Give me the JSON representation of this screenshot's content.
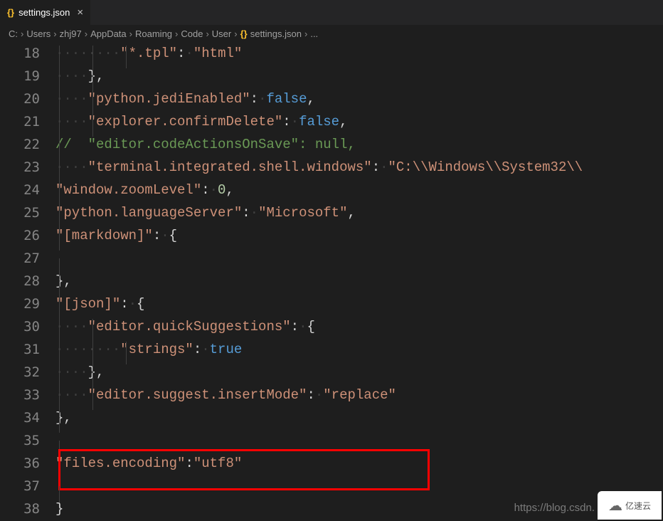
{
  "tab": {
    "icon": "{}",
    "title": "settings.json",
    "close": "×"
  },
  "breadcrumb": {
    "items": [
      "C:",
      "Users",
      "zhj97",
      "AppData",
      "Roaming",
      "Code",
      "User"
    ],
    "file_icon": "{}",
    "file": "settings.json",
    "trail": "..."
  },
  "lines": [
    {
      "n": "18",
      "seg": [
        {
          "t": "ws",
          "v": "········"
        },
        {
          "t": "str",
          "v": "\"*.tpl\""
        },
        {
          "t": "p",
          "v": ":"
        },
        {
          "t": "ws",
          "v": "·"
        },
        {
          "t": "str",
          "v": "\"html\""
        }
      ],
      "g": 3
    },
    {
      "n": "19",
      "seg": [
        {
          "t": "ws",
          "v": "····"
        },
        {
          "t": "p",
          "v": "},"
        }
      ],
      "g": 2
    },
    {
      "n": "20",
      "seg": [
        {
          "t": "ws",
          "v": "····"
        },
        {
          "t": "str",
          "v": "\"python.jediEnabled\""
        },
        {
          "t": "p",
          "v": ":"
        },
        {
          "t": "ws",
          "v": "·"
        },
        {
          "t": "kc",
          "v": "false"
        },
        {
          "t": "p",
          "v": ","
        }
      ],
      "g": 2
    },
    {
      "n": "21",
      "seg": [
        {
          "t": "ws",
          "v": "····"
        },
        {
          "t": "str",
          "v": "\"explorer.confirmDelete\""
        },
        {
          "t": "p",
          "v": ":"
        },
        {
          "t": "ws",
          "v": "·"
        },
        {
          "t": "kc",
          "v": "false"
        },
        {
          "t": "p",
          "v": ","
        }
      ],
      "g": 2
    },
    {
      "n": "22",
      "seg": [
        {
          "t": "cm",
          "v": "//  \"editor.codeActionsOnSave\": null,"
        }
      ],
      "g": 1
    },
    {
      "n": "23",
      "seg": [
        {
          "t": "ws",
          "v": "····"
        },
        {
          "t": "str",
          "v": "\"terminal.integrated.shell.windows\""
        },
        {
          "t": "p",
          "v": ":"
        },
        {
          "t": "ws",
          "v": "·"
        },
        {
          "t": "str",
          "v": "\"C:\\\\Windows\\\\System32\\\\"
        }
      ],
      "g": 1
    },
    {
      "n": "24",
      "seg": [
        {
          "t": "str",
          "v": "\"window.zoomLevel\""
        },
        {
          "t": "p",
          "v": ":"
        },
        {
          "t": "ws",
          "v": "·"
        },
        {
          "t": "num",
          "v": "0"
        },
        {
          "t": "p",
          "v": ","
        }
      ],
      "g": 1
    },
    {
      "n": "25",
      "seg": [
        {
          "t": "str",
          "v": "\"python.languageServer\""
        },
        {
          "t": "p",
          "v": ":"
        },
        {
          "t": "ws",
          "v": "·"
        },
        {
          "t": "str",
          "v": "\"Microsoft\""
        },
        {
          "t": "p",
          "v": ","
        }
      ],
      "g": 1
    },
    {
      "n": "26",
      "seg": [
        {
          "t": "str",
          "v": "\"[markdown]\""
        },
        {
          "t": "p",
          "v": ":"
        },
        {
          "t": "ws",
          "v": "·"
        },
        {
          "t": "p",
          "v": "{"
        }
      ],
      "g": 1
    },
    {
      "n": "27",
      "seg": [],
      "g": 1
    },
    {
      "n": "28",
      "seg": [
        {
          "t": "p",
          "v": "},"
        }
      ],
      "g": 1
    },
    {
      "n": "29",
      "seg": [
        {
          "t": "str",
          "v": "\"[json]\""
        },
        {
          "t": "p",
          "v": ":"
        },
        {
          "t": "ws",
          "v": "·"
        },
        {
          "t": "p",
          "v": "{"
        }
      ],
      "g": 1
    },
    {
      "n": "30",
      "seg": [
        {
          "t": "ws",
          "v": "····"
        },
        {
          "t": "str",
          "v": "\"editor.quickSuggestions\""
        },
        {
          "t": "p",
          "v": ":"
        },
        {
          "t": "ws",
          "v": "·"
        },
        {
          "t": "p",
          "v": "{"
        }
      ],
      "g": 2
    },
    {
      "n": "31",
      "seg": [
        {
          "t": "ws",
          "v": "········"
        },
        {
          "t": "str",
          "v": "\"strings\""
        },
        {
          "t": "p",
          "v": ":"
        },
        {
          "t": "ws",
          "v": "·"
        },
        {
          "t": "kc",
          "v": "true"
        }
      ],
      "g": 3
    },
    {
      "n": "32",
      "seg": [
        {
          "t": "ws",
          "v": "····"
        },
        {
          "t": "p",
          "v": "},"
        }
      ],
      "g": 2
    },
    {
      "n": "33",
      "seg": [
        {
          "t": "ws",
          "v": "····"
        },
        {
          "t": "str",
          "v": "\"editor.suggest.insertMode\""
        },
        {
          "t": "p",
          "v": ":"
        },
        {
          "t": "ws",
          "v": "·"
        },
        {
          "t": "str",
          "v": "\"replace\""
        }
      ],
      "g": 2
    },
    {
      "n": "34",
      "seg": [
        {
          "t": "p",
          "v": "},"
        }
      ],
      "g": 1
    },
    {
      "n": "35",
      "seg": [],
      "g": 1
    },
    {
      "n": "36",
      "seg": [
        {
          "t": "str",
          "v": "\"files.encoding\""
        },
        {
          "t": "p",
          "v": ":"
        },
        {
          "t": "str",
          "v": "\"utf8\""
        }
      ],
      "g": 1
    },
    {
      "n": "37",
      "seg": [],
      "g": 1
    },
    {
      "n": "38",
      "seg": [
        {
          "t": "p",
          "v": "}"
        }
      ],
      "g": 0
    }
  ],
  "highlight": {
    "line": "36"
  },
  "watermark": "https://blog.csdn.",
  "logo": "亿速云"
}
